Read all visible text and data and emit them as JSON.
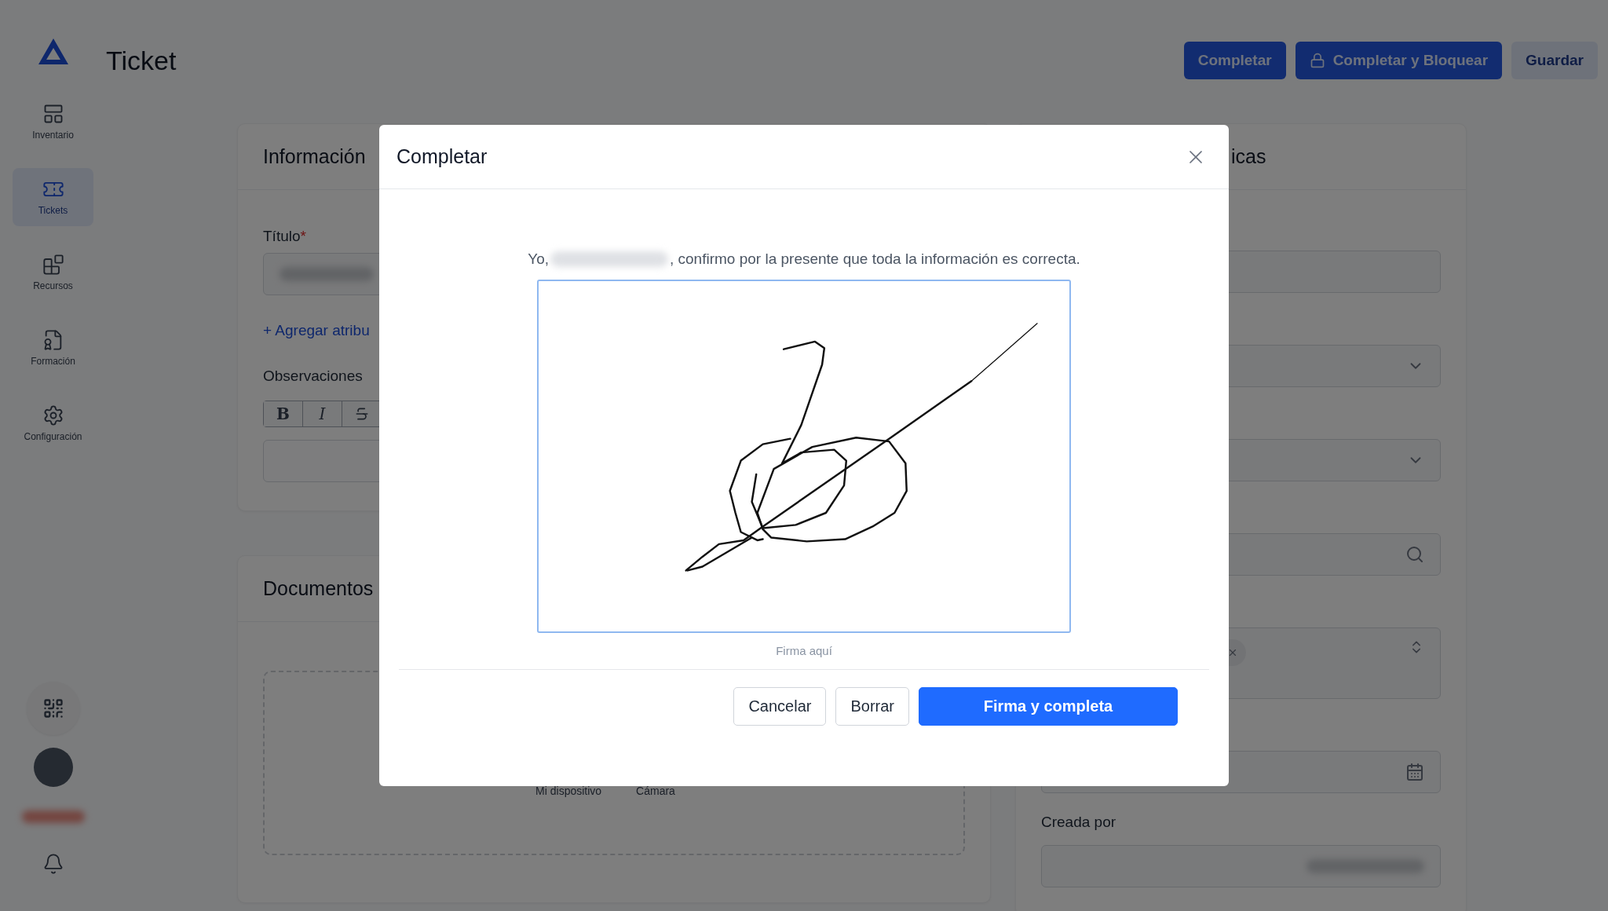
{
  "sidebar": {
    "items": [
      {
        "kind": "inventory",
        "label": "Inventario",
        "selected": false
      },
      {
        "kind": "tickets",
        "label": "Tickets",
        "selected": true
      },
      {
        "kind": "resources",
        "label": "Recursos",
        "selected": false
      },
      {
        "kind": "training",
        "label": "Formación",
        "selected": false
      },
      {
        "kind": "settings",
        "label": "Configuración",
        "selected": false
      }
    ]
  },
  "page": {
    "title": "Ticket"
  },
  "header_buttons": [
    {
      "label": "Completar",
      "kind": "primary"
    },
    {
      "label": "Completar y Bloquear",
      "kind": "lock"
    },
    {
      "label": "Guardar",
      "kind": "secondary"
    }
  ],
  "general_card": {
    "title": "Información",
    "title_label": "Título",
    "required_mark": "*",
    "title_value_hidden": true,
    "add_link": "+ Agregar atribu",
    "notes_label": "Observaciones",
    "toolbar": [
      {
        "kind": "bold",
        "glyph": "B"
      },
      {
        "kind": "italic",
        "glyph": "I"
      },
      {
        "kind": "strike"
      }
    ]
  },
  "documents_card": {
    "title": "Documentos",
    "sources": [
      "Mi dispositivo",
      "Cámara"
    ]
  },
  "details_card": {
    "title": "icas",
    "fields": [
      {
        "kind": "text"
      },
      {
        "kind": "select"
      },
      {
        "kind": "select"
      },
      {
        "kind": "search"
      },
      {
        "kind": "multiselect"
      },
      {
        "kind": "date"
      },
      {
        "kind": "text",
        "label": "Creada por",
        "value_hidden": true
      }
    ]
  },
  "modal": {
    "title": "Completar",
    "statement_start": "Yo,",
    "name_hidden": true,
    "statement_end": ", confirmo por la presente que toda la información es correcta.",
    "pad_caption": "Firma aquí",
    "buttons": [
      {
        "label": "Cancelar",
        "kind": "outline"
      },
      {
        "label": "Borrar",
        "kind": "outline"
      },
      {
        "label": "Firma y completa",
        "kind": "primary"
      }
    ]
  }
}
